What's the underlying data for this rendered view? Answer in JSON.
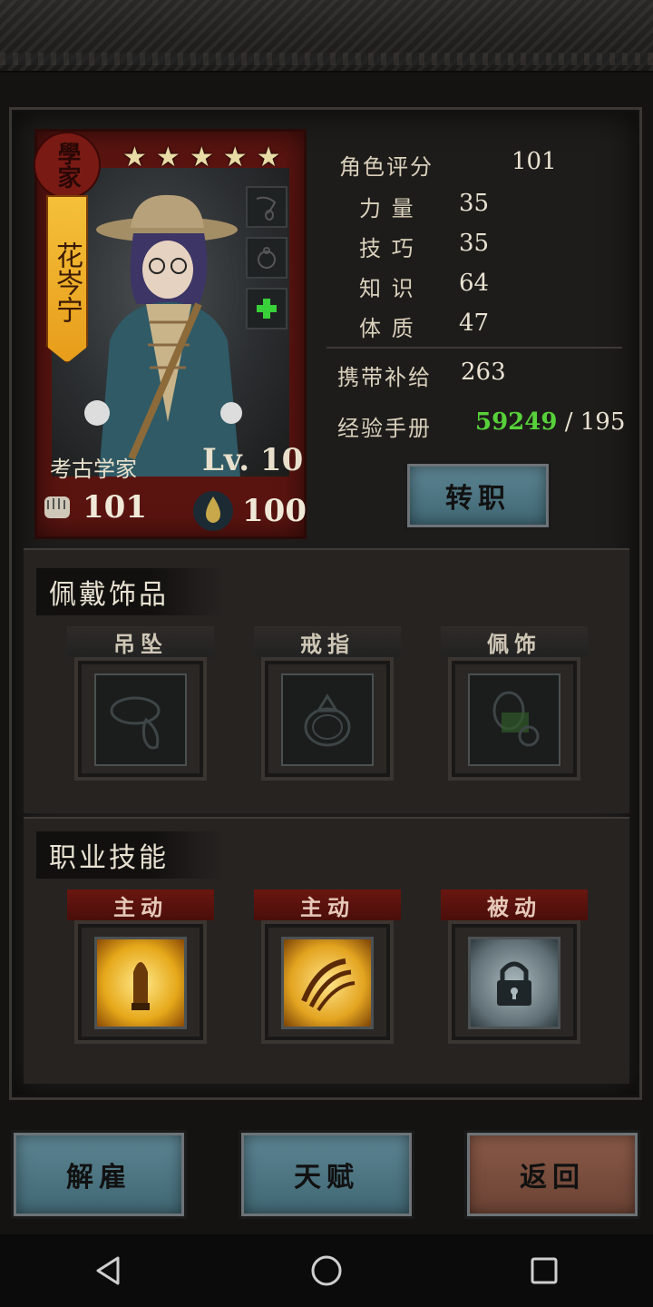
{
  "hero": {
    "seal_text": "學家",
    "name": "花岑宁",
    "stars": 5,
    "class_name": "考古学家",
    "level": "Lv. 10",
    "attack": "101",
    "hp": "100"
  },
  "stats": {
    "rating_label": "角色评分",
    "rating_value": "101",
    "strength_label": "力 量",
    "strength_value": "35",
    "skill_label": "技 巧",
    "skill_value": "35",
    "knowledge_label": "知 识",
    "knowledge_value": "64",
    "physique_label": "体 质",
    "physique_value": "47",
    "supply_label": "携带补给",
    "supply_value": "263",
    "exp_label": "经验手册",
    "exp_current": "59249",
    "exp_sep": " / ",
    "exp_required": "195"
  },
  "buttons": {
    "change_class": "转职",
    "dismiss": "解雇",
    "talent": "天赋",
    "back": "返回"
  },
  "accessories": {
    "title": "佩戴饰品",
    "slots": [
      {
        "label": "吊坠",
        "icon": "pendant-icon"
      },
      {
        "label": "戒指",
        "icon": "ring-icon"
      },
      {
        "label": "佩饰",
        "icon": "charm-icon"
      }
    ]
  },
  "skills": {
    "title": "职业技能",
    "slots": [
      {
        "label": "主动",
        "icon": "bullet-skill-icon"
      },
      {
        "label": "主动",
        "icon": "claw-skill-icon"
      },
      {
        "label": "被动",
        "icon": "locked-skill-icon"
      }
    ]
  },
  "colors": {
    "exp_green": "#57d13a",
    "card_red": "#5a1410",
    "button_blue": "#4f7683",
    "button_brown": "#7a4e3f"
  }
}
